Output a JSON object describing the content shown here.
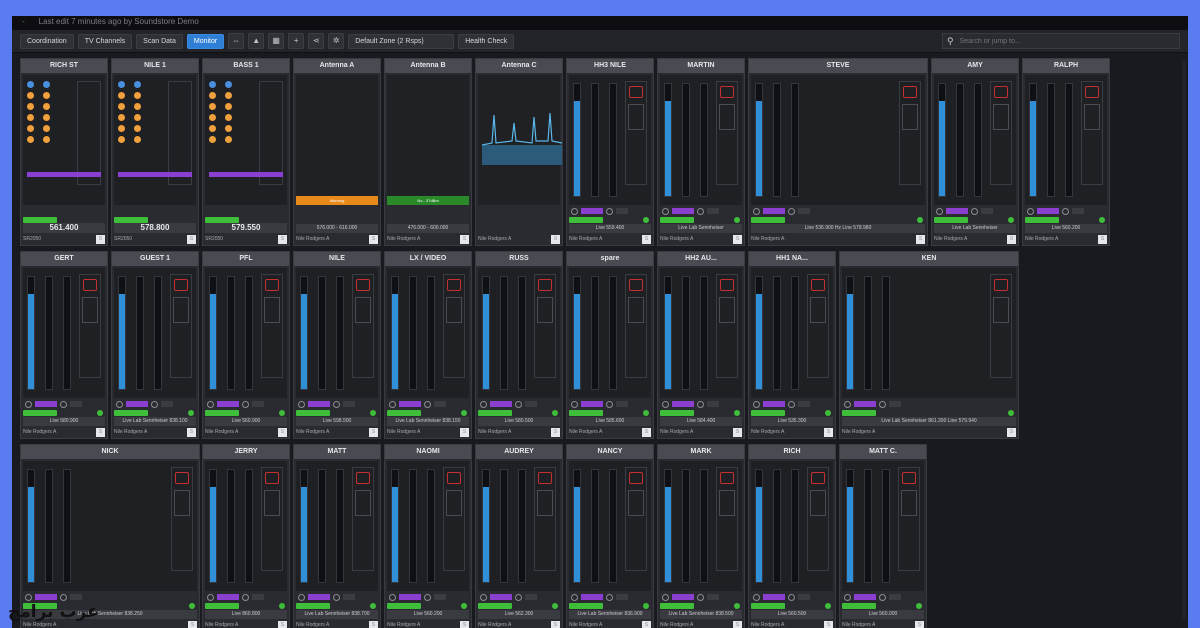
{
  "titlebar": {
    "brand": "-",
    "text": "Last edit 7 minutes ago by Soundstore Demo"
  },
  "toolbar": {
    "tabs": [
      {
        "label": "Coordination",
        "active": false
      },
      {
        "label": "TV Channels",
        "active": false
      },
      {
        "label": "Scan Data",
        "active": false
      },
      {
        "label": "Monitor",
        "active": true
      }
    ],
    "zone_select": "Default Zone (2 Rsps)",
    "health_label": "Health Check",
    "search_placeholder": "Search or jump to..."
  },
  "receivers": [
    {
      "name": "RICH ST",
      "freq": "561.400",
      "model": "SR2050"
    },
    {
      "name": "NILE 1",
      "freq": "578.800",
      "model": "SR2050"
    },
    {
      "name": "BASS 1",
      "freq": "579.550",
      "model": "SR2050"
    }
  ],
  "antennas": [
    {
      "name": "Antenna A",
      "status": "Warning",
      "range": "576.000 - 616.000"
    },
    {
      "name": "Antenna B",
      "status": "No - 37dBm",
      "range": "476.000 - 600.000"
    },
    {
      "name": "Antenna C",
      "status": "",
      "range": ""
    }
  ],
  "channels_row1": [
    {
      "name": "HH3 NILE",
      "freq": "Live 559.400",
      "owner": "Nile Rodgers A"
    },
    {
      "name": "MARTIN",
      "freq": "Live Lab Sennheiser",
      "owner": "Nile Rodgers A"
    },
    {
      "name": "STEVE",
      "freq": "Line 536.900 Hz Line 578.980",
      "owner": "Nile Rodgers A"
    },
    {
      "name": "AMY",
      "freq": "Live Lab Sennheiser",
      "owner": "Nile Rodgers A"
    },
    {
      "name": "RALPH",
      "freq": "Live 560.200",
      "owner": "Nile Rodgers A"
    }
  ],
  "channels_row2": [
    {
      "name": "GERT",
      "freq": "Live 580.900",
      "owner": "Nile Rodgers A"
    },
    {
      "name": "GUEST 1",
      "freq": "Live Lab Sennheiser 838.100",
      "owner": "Nile Rodgers A"
    },
    {
      "name": "PFL",
      "freq": "Live 560.900",
      "owner": "Nile Rodgers A"
    },
    {
      "name": "NILE",
      "freq": "Live 598.500",
      "owner": "Nile Rodgers A"
    },
    {
      "name": "LX / VIDEO",
      "freq": "Live Lab Sennheiser 838.150",
      "owner": "Nile Rodgers A"
    },
    {
      "name": "RUSS",
      "freq": "Live 580.500",
      "owner": "Nile Rodgers A"
    },
    {
      "name": "spare",
      "freq": "Live 585.600",
      "owner": "Nile Rodgers A"
    },
    {
      "name": "HH2 AU...",
      "freq": "Live 584.400",
      "owner": "Nile Rodgers A"
    },
    {
      "name": "HH1 NA...",
      "freq": "Live 535.300",
      "owner": "Nile Rodgers A"
    },
    {
      "name": "KEN",
      "freq": "Live Lab Sennheiser 861.300 Line 579.940",
      "owner": "Nile Rodgers A"
    }
  ],
  "channels_row3": [
    {
      "name": "NICK",
      "freq": "Live Lab Sennheiser 838.250",
      "owner": "Nile Rodgers A"
    },
    {
      "name": "JERRY",
      "freq": "Live 860.800",
      "owner": "Nile Rodgers A"
    },
    {
      "name": "MATT",
      "freq": "Live Lab Sennheiser 838.700",
      "owner": "Nile Rodgers A"
    },
    {
      "name": "NAOMI",
      "freq": "Live 560.200",
      "owner": "Nile Rodgers A"
    },
    {
      "name": "AUDREY",
      "freq": "Live 562.300",
      "owner": "Nile Rodgers A"
    },
    {
      "name": "NANCY",
      "freq": "Live Lab Sennheiser 836.900",
      "owner": "Nile Rodgers A"
    },
    {
      "name": "MARK",
      "freq": "Live Lab Sennheiser 838.500",
      "owner": "Nile Rodgers A"
    },
    {
      "name": "RICH",
      "freq": "Live 560.500",
      "owner": "Nile Rodgers A"
    },
    {
      "name": "MATT C.",
      "freq": "Live 560.000",
      "owner": "Nile Rodgers A"
    }
  ],
  "watermark": "عرب برامج",
  "colors": {
    "accent": "#2f7fd6",
    "meter": "#2f8fd8",
    "battery": "#3fbe3a",
    "purple": "#8a3fd1",
    "warning": "#e88a1a",
    "ok_green": "#2a8a2a"
  }
}
